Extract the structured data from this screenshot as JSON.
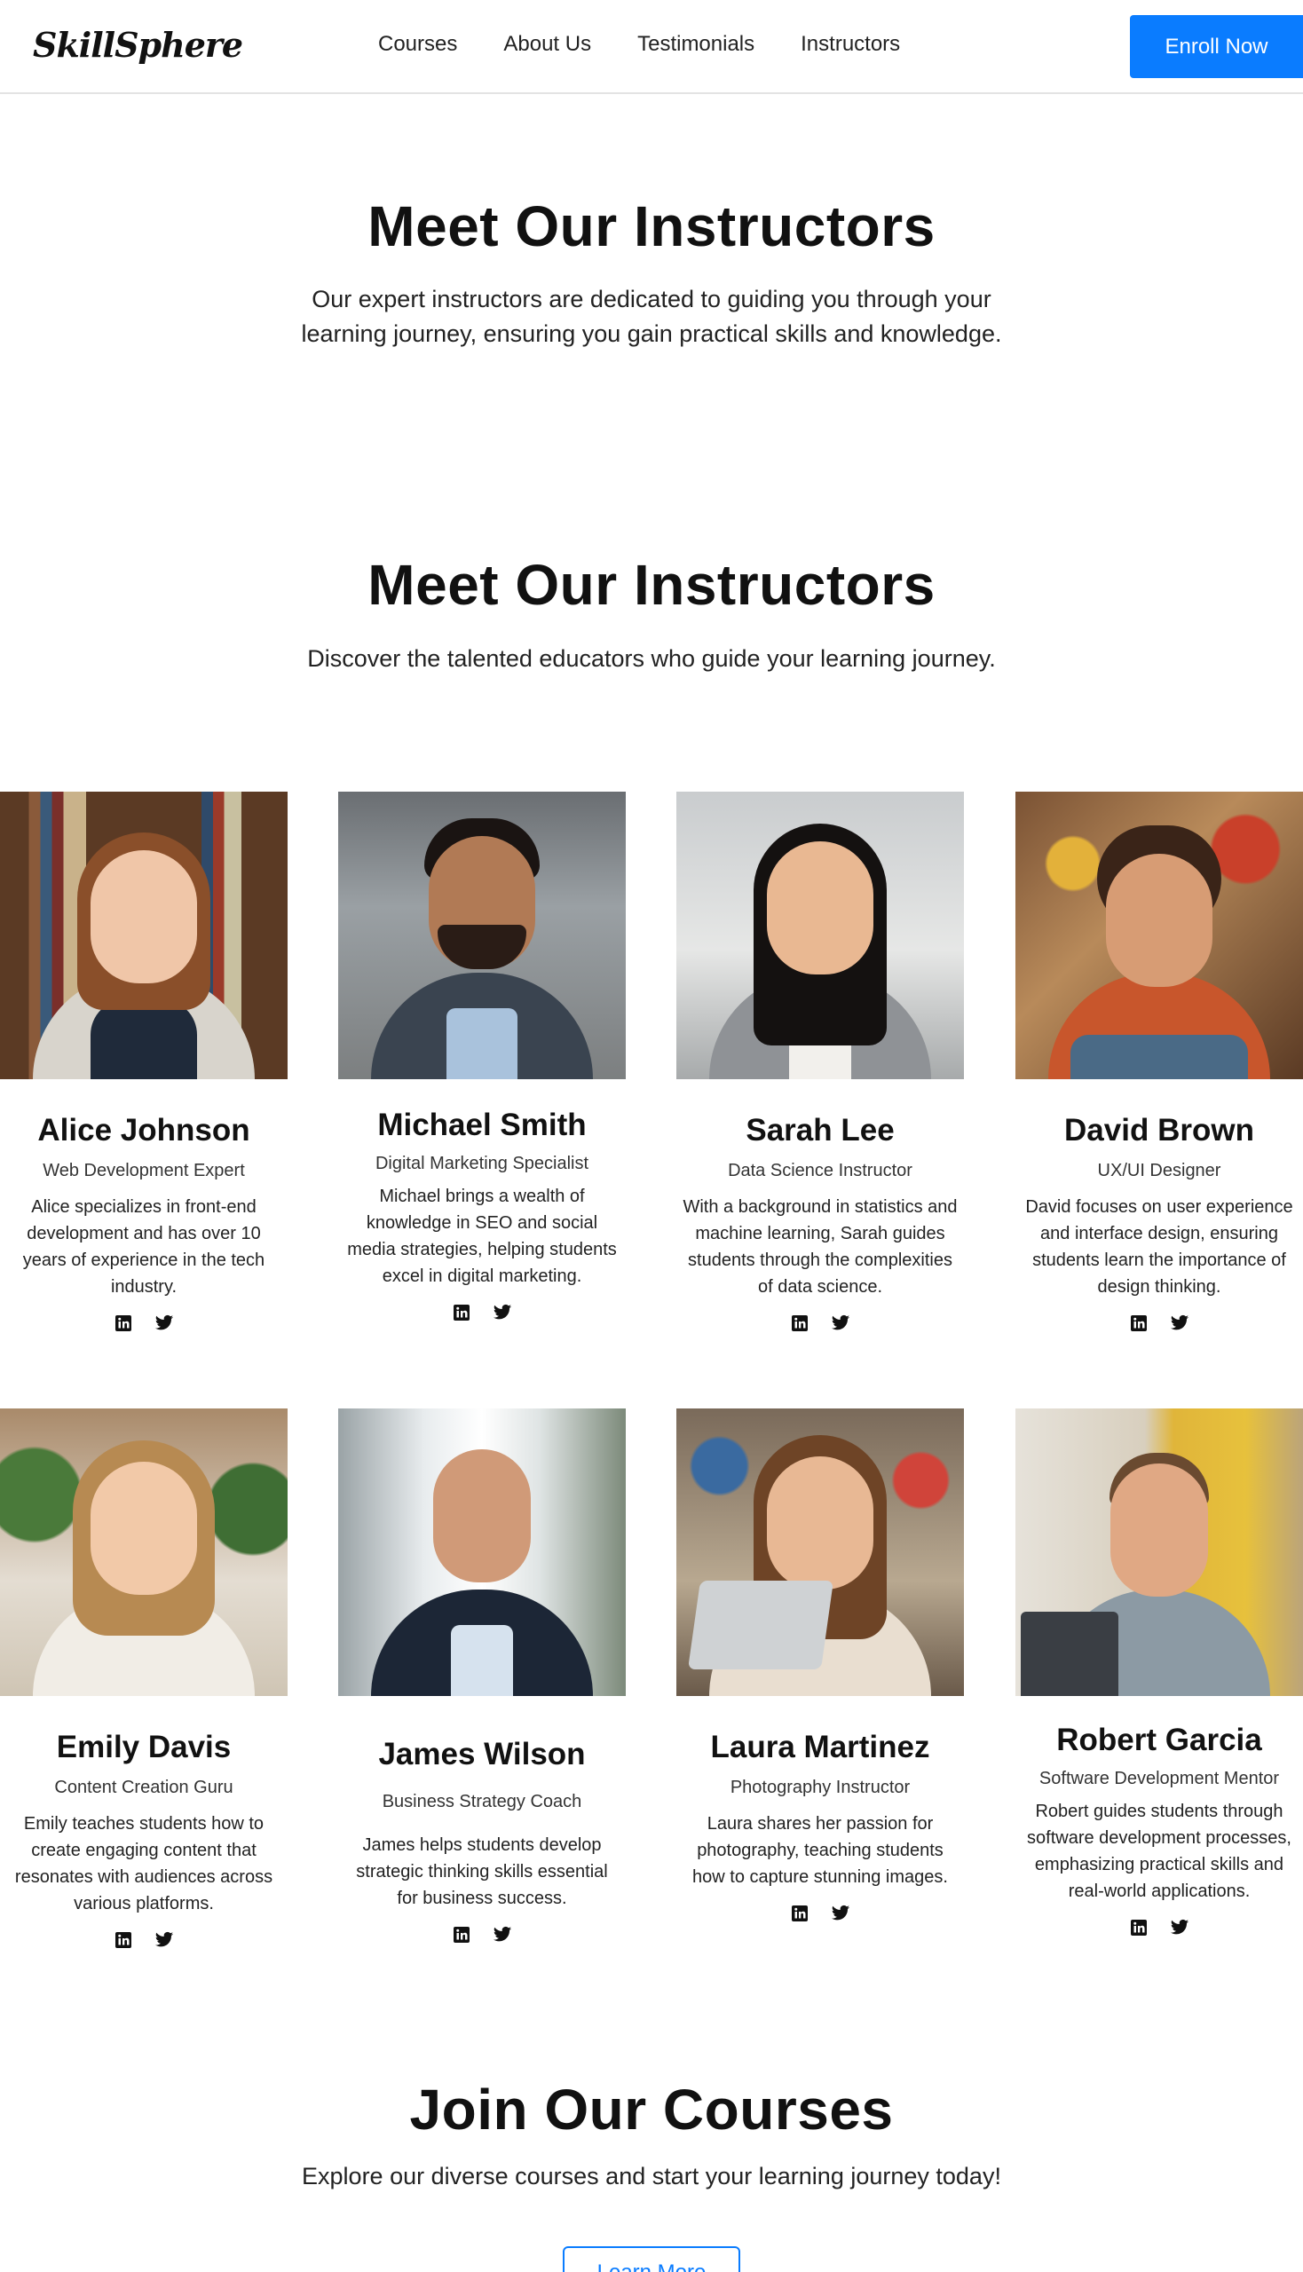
{
  "nav": {
    "logo": "SkillSphere",
    "links": [
      "Courses",
      "About Us",
      "Testimonials",
      "Instructors"
    ],
    "cta": "Enroll Now"
  },
  "hero": {
    "title": "Meet Our Instructors",
    "subtitle": "Our expert instructors are dedicated to guiding you through your learning journey, ensuring you gain practical skills and knowledge."
  },
  "instructors_section": {
    "title": "Meet Our Instructors",
    "subtitle": "Discover the talented educators who guide your learning journey."
  },
  "instructors": [
    {
      "name": "Alice Johnson",
      "role": "Web Development Expert",
      "bio": "Alice specializes in front-end development and has over 10 years of experience in the tech industry."
    },
    {
      "name": "Michael Smith",
      "role": "Digital Marketing Specialist",
      "bio": "Michael brings a wealth of knowledge in SEO and social media strategies, helping students excel in digital marketing."
    },
    {
      "name": "Sarah Lee",
      "role": "Data Science Instructor",
      "bio": "With a background in statistics and machine learning, Sarah guides students through the complexities of data science."
    },
    {
      "name": "David Brown",
      "role": "UX/UI Designer",
      "bio": "David focuses on user experience and interface design, ensuring students learn the importance of design thinking."
    },
    {
      "name": "Emily Davis",
      "role": "Content Creation Guru",
      "bio": "Emily teaches students how to create engaging content that resonates with audiences across various platforms."
    },
    {
      "name": "James Wilson",
      "role": "Business Strategy Coach",
      "bio": "James helps students develop strategic thinking skills essential for business success."
    },
    {
      "name": "Laura Martinez",
      "role": "Photography Instructor",
      "bio": "Laura shares her passion for photography, teaching students how to capture stunning images."
    },
    {
      "name": "Robert Garcia",
      "role": "Software Development Mentor",
      "bio": "Robert guides students through software development processes, emphasizing practical skills and real-world applications."
    }
  ],
  "social_icons": [
    "linkedin-icon",
    "twitter-icon"
  ],
  "join": {
    "title": "Join Our Courses",
    "subtitle": "Explore our diverse courses and start your learning journey today!",
    "button": "Learn More"
  },
  "colors": {
    "accent": "#0a7cff",
    "text": "#111111"
  }
}
